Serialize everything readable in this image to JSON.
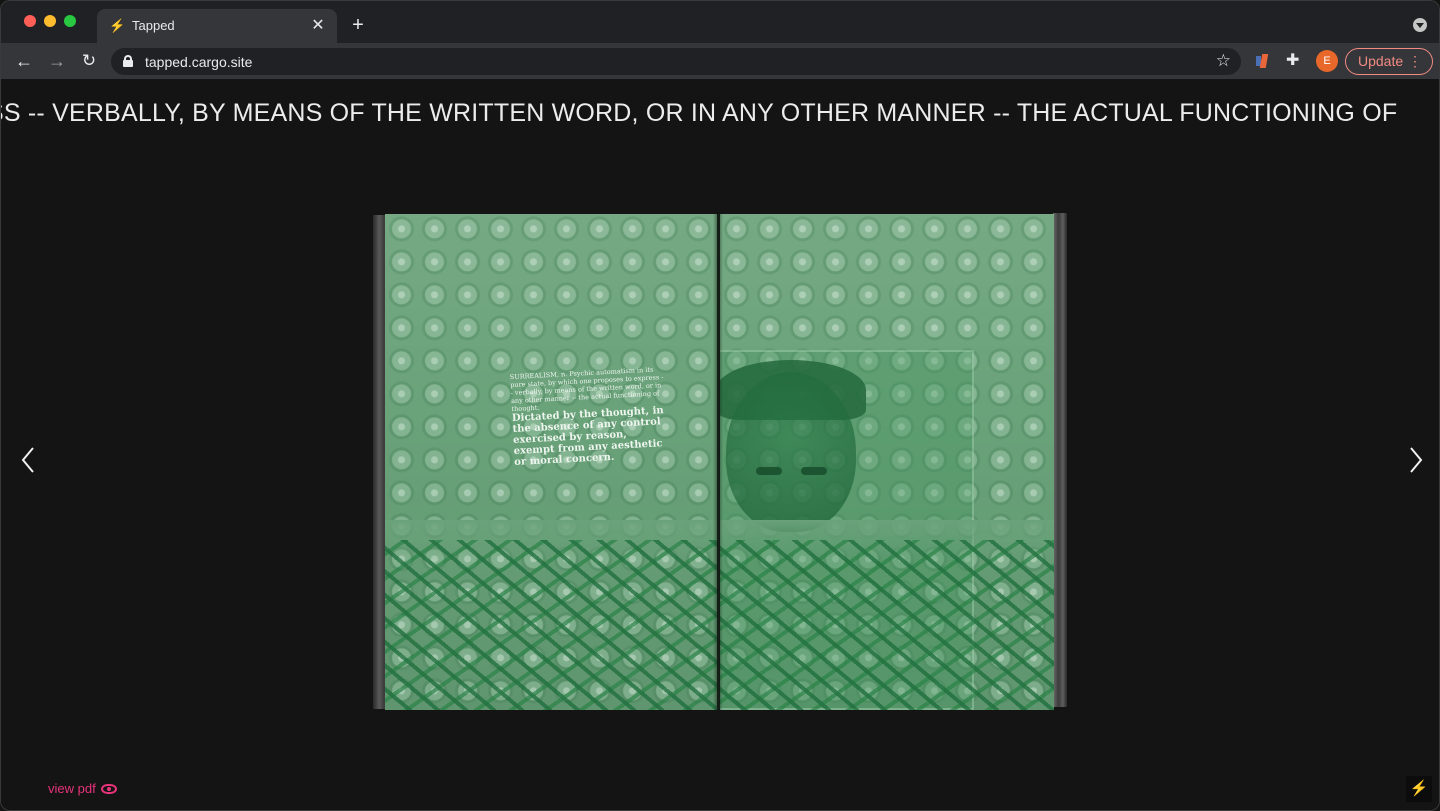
{
  "browser": {
    "tab_title": "Tapped",
    "tab_favicon": "⚡",
    "url": "tapped.cargo.site",
    "profile_initial": "E",
    "update_label": "Update"
  },
  "page": {
    "marquee_text": "SS -- VERBALLY, BY MEANS OF THE WRITTEN WORD, OR IN ANY OTHER MANNER -- THE ACTUAL FUNCTIONING OF",
    "caption_small": "SURREALISM, n. Psychic automatism in its pure state, by which one proposes to express -- verbally, by means of the written word, or in any other manner -- the actual functioning of thought.",
    "caption_big": "Dictated by the thought, in the absence of any control exercised by reason, exempt from any aesthetic or moral concern.",
    "view_pdf_label": "view pdf",
    "corner_icon": "⚡"
  },
  "colors": {
    "accent_pink": "#e6337a",
    "page_green": "#6aa27a",
    "update_red": "#f28b82"
  }
}
